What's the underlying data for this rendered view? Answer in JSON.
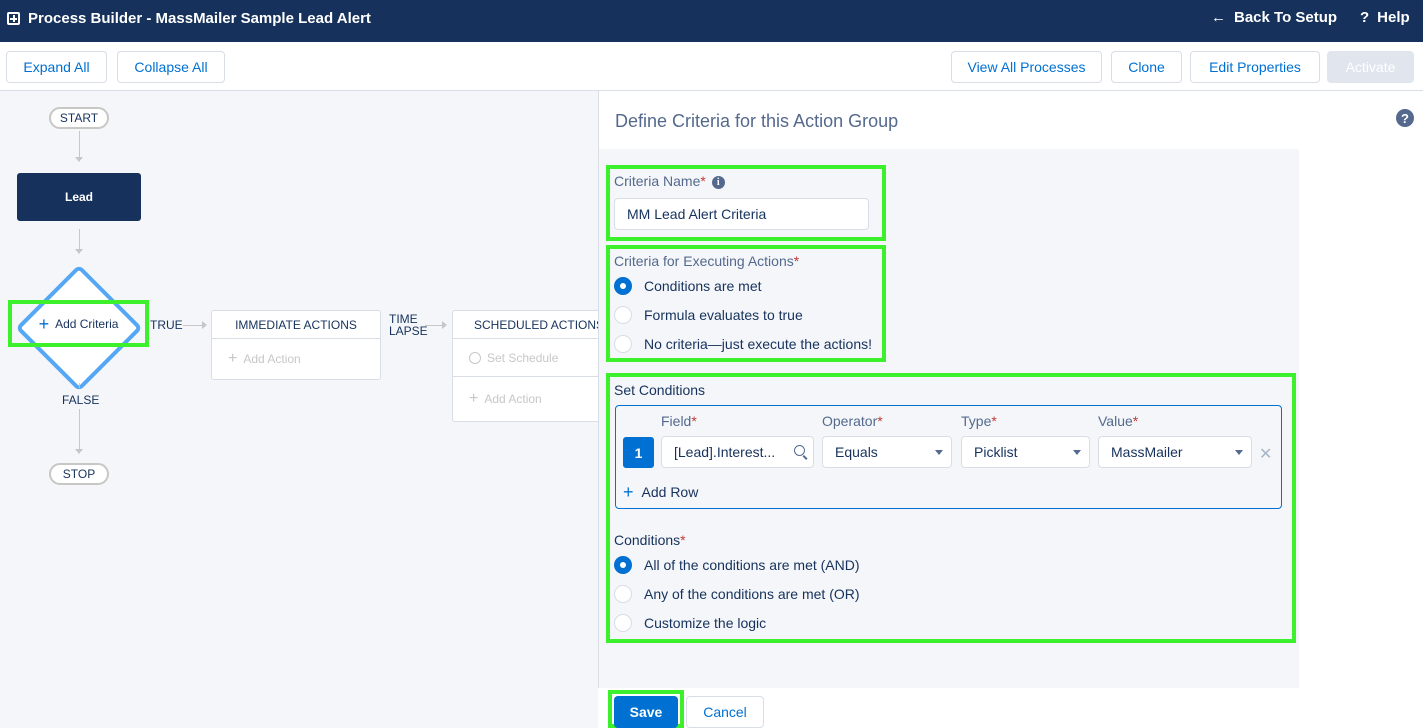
{
  "header": {
    "title": "Process Builder - MassMailer Sample Lead Alert",
    "back_label": "Back To Setup",
    "help_label": "Help"
  },
  "toolbar": {
    "expand_all": "Expand All",
    "collapse_all": "Collapse All",
    "view_all_processes": "View All Processes",
    "clone": "Clone",
    "edit_properties": "Edit Properties",
    "activate": "Activate"
  },
  "canvas": {
    "start": "START",
    "object": "Lead",
    "add_criteria": "Add Criteria",
    "true_label": "TRUE",
    "false_label": "FALSE",
    "stop": "STOP",
    "immediate_actions": "IMMEDIATE ACTIONS",
    "add_action": "Add Action",
    "time_lapse_line1": "TIME",
    "time_lapse_line2": "LAPSE",
    "scheduled_actions": "SCHEDULED ACTIONS",
    "set_schedule": "Set Schedule",
    "add_action_2": "Add Action"
  },
  "panel": {
    "title": "Define Criteria for this Action Group",
    "criteria_name_label": "Criteria Name",
    "criteria_name_value": "MM Lead Alert Criteria",
    "executing_label": "Criteria for Executing Actions",
    "executing_options": [
      {
        "label": "Conditions are met",
        "selected": true
      },
      {
        "label": "Formula evaluates to true",
        "selected": false
      },
      {
        "label": "No criteria—just execute the actions!",
        "selected": false
      }
    ],
    "set_conditions_label": "Set Conditions",
    "columns": {
      "field": "Field",
      "operator": "Operator",
      "type": "Type",
      "value": "Value"
    },
    "row": {
      "number": "1",
      "field": "[Lead].Interest...",
      "operator": "Equals",
      "type": "Picklist",
      "value": "MassMailer"
    },
    "add_row": "Add Row",
    "conditions_label": "Conditions",
    "conditions_options": [
      {
        "label": "All of the conditions are met (AND)",
        "selected": true
      },
      {
        "label": "Any of the conditions are met (OR)",
        "selected": false
      },
      {
        "label": "Customize the logic",
        "selected": false
      }
    ],
    "save": "Save",
    "cancel": "Cancel"
  },
  "colors": {
    "header_bg": "#16325c",
    "accent": "#0070d2",
    "highlight": "#3cf12b",
    "diamond": "#54a7f5"
  }
}
